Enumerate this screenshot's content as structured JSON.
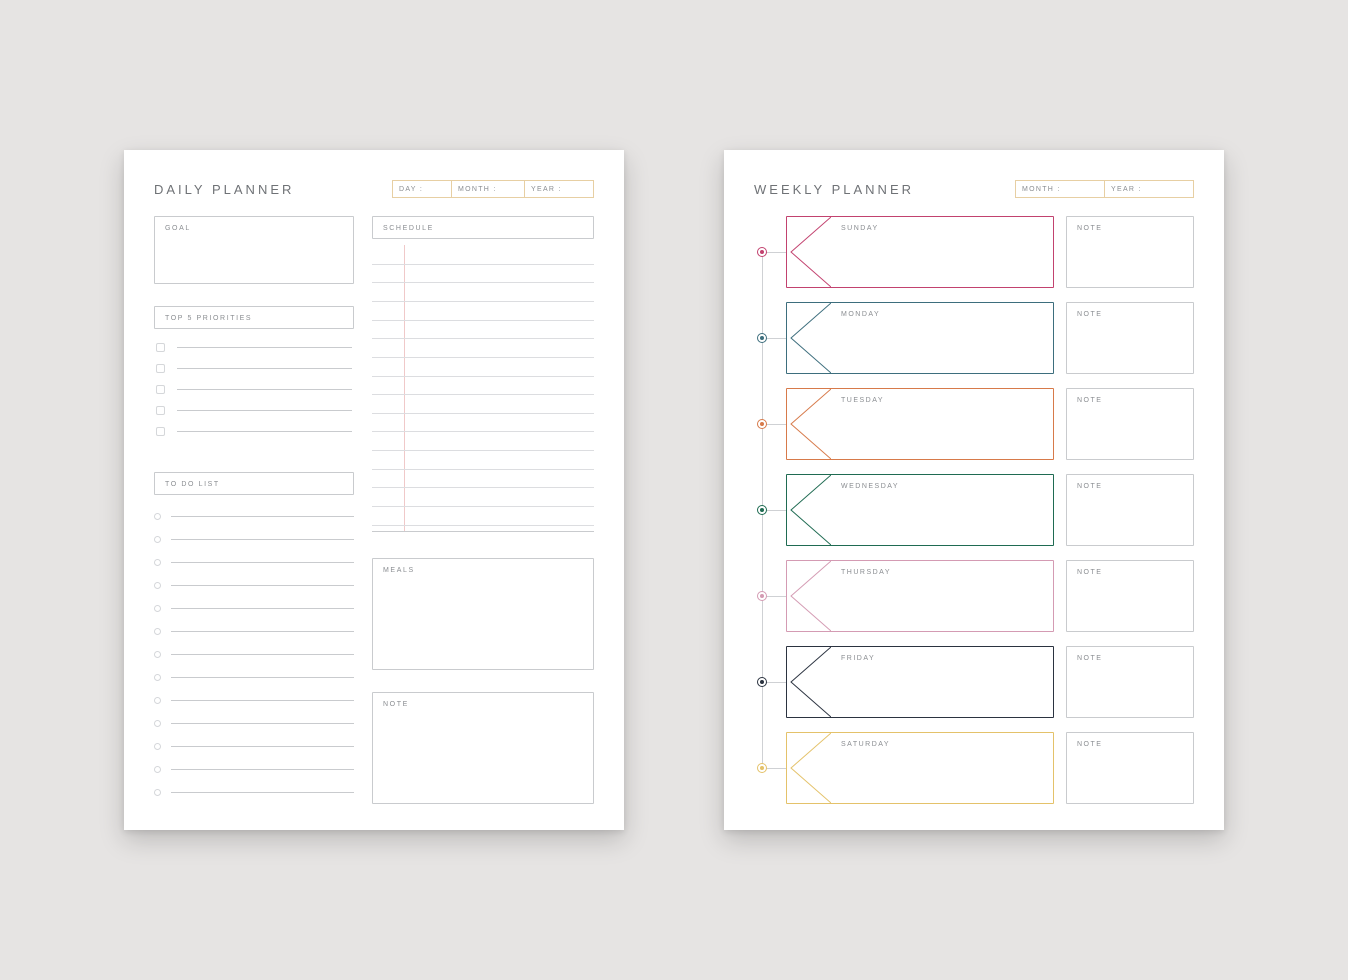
{
  "daily": {
    "title": "DAILY PLANNER",
    "date_fields": [
      {
        "label": "DAY :",
        "color": "#e7cfa3"
      },
      {
        "label": "MONTH :",
        "color": "#e7cfa3"
      },
      {
        "label": "YEAR :",
        "color": "#e7cfa3"
      }
    ],
    "sections": {
      "goal": "GOAL",
      "priorities": "TOP 5 PRIORITIES",
      "todo": "TO DO LIST",
      "schedule": "SCHEDULE",
      "meals": "MEALS",
      "note": "NOTE"
    },
    "priority_rows": 5,
    "todo_rows": 13,
    "schedule_rows": 16
  },
  "weekly": {
    "title": "WEEKLY PLANNER",
    "date_fields": [
      {
        "label": "MONTH :",
        "color": "#e7cfa3"
      },
      {
        "label": "YEAR :",
        "color": "#e7cfa3"
      }
    ],
    "note_label": "NOTE",
    "days": [
      {
        "name": "SUNDAY",
        "color": "#c2426f"
      },
      {
        "name": "MONDAY",
        "color": "#3d6e7d"
      },
      {
        "name": "TUESDAY",
        "color": "#d77a4a"
      },
      {
        "name": "WEDNESDAY",
        "color": "#1f6b52"
      },
      {
        "name": "THURSDAY",
        "color": "#d49bb3"
      },
      {
        "name": "FRIDAY",
        "color": "#2b3340"
      },
      {
        "name": "SATURDAY",
        "color": "#e4c26a"
      }
    ]
  }
}
